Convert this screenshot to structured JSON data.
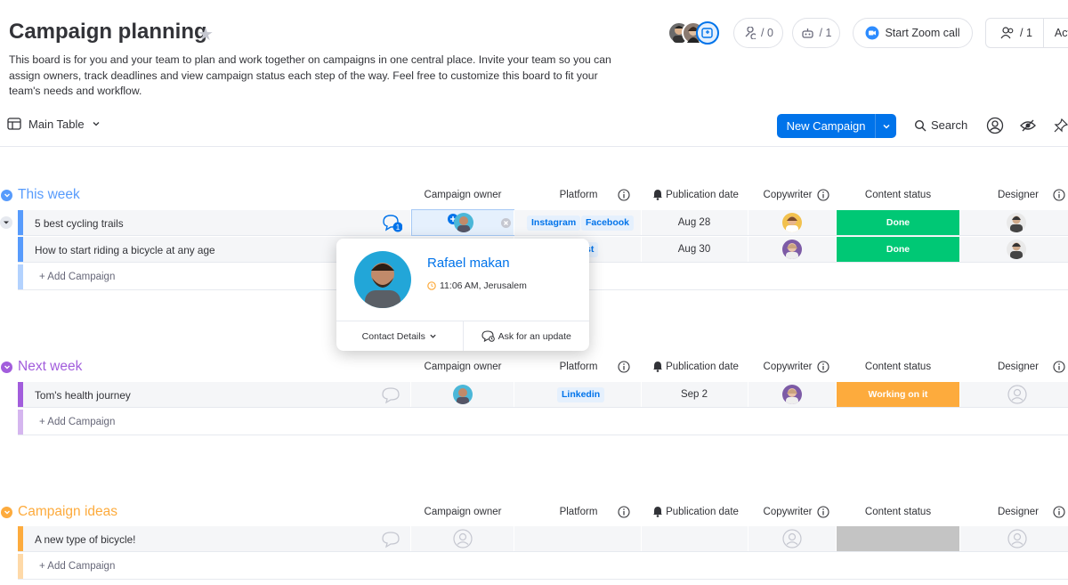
{
  "header": {
    "title": "Campaign planning",
    "description": "This board is for you and your team to plan and work together on campaigns in one central place. Invite your team so you can assign owners, track deadlines and view campaign status each step of the way. Feel free to customize this board to fit your team's needs and workflow.",
    "integrations_count": "/ 0",
    "automations_count": "/ 1",
    "zoom_label": "Start Zoom call",
    "members_count": "/ 1",
    "activity_label": "Activi"
  },
  "toolbar": {
    "view_label": "Main Table",
    "new_button_label": "New Campaign",
    "search_label": "Search"
  },
  "columns": {
    "owner": "Campaign owner",
    "platform": "Platform",
    "date": "Publication date",
    "copywriter": "Copywriter",
    "status": "Content status",
    "designer": "Designer"
  },
  "groups": [
    {
      "title": "This week",
      "color": "#579bfc",
      "add_label": "+ Add Campaign",
      "rows": [
        {
          "name": "5 best cycling trails",
          "platforms": [
            "Instagram",
            "Facebook"
          ],
          "date": "Aug 28",
          "status": "Done",
          "status_color": "#00c875",
          "updates": "1"
        },
        {
          "name": "How to start riding a bicycle at any age",
          "platforms": [
            "st"
          ],
          "date": "Aug 30",
          "status": "Done",
          "status_color": "#00c875"
        }
      ]
    },
    {
      "title": "Next week",
      "color": "#a25ddc",
      "add_label": "+ Add Campaign",
      "rows": [
        {
          "name": "Tom's health journey",
          "platforms": [
            "Linkedin"
          ],
          "date": "Sep 2",
          "status": "Working on it",
          "status_color": "#fdab3d"
        }
      ]
    },
    {
      "title": "Campaign ideas",
      "color": "#fdab3d",
      "add_label": "+ Add Campaign",
      "rows": [
        {
          "name": "A new type of bicycle!",
          "platforms": [],
          "date": "",
          "status": "",
          "status_color": "#c4c4c4"
        }
      ]
    }
  ],
  "person_card": {
    "name": "Rafael makan",
    "local_time": "11:06 AM, Jerusalem",
    "contact_label": "Contact Details",
    "ask_label": "Ask for an update"
  },
  "colors": {
    "primary": "#0073ea",
    "done": "#00c875",
    "working": "#fdab3d",
    "empty_status": "#c4c4c4"
  }
}
